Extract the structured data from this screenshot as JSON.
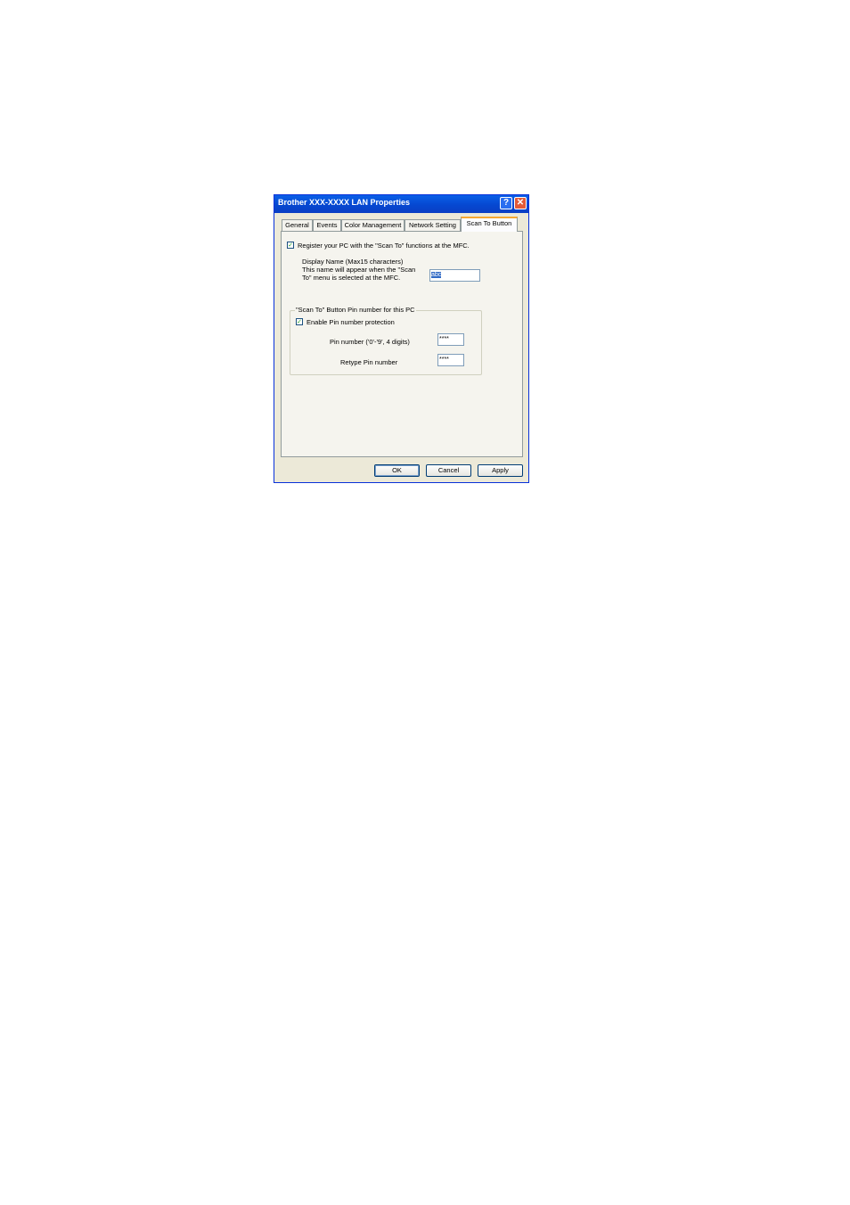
{
  "window": {
    "title": "Brother XXX-XXXX LAN Properties",
    "help_glyph": "?",
    "close_glyph": "✕"
  },
  "tabs": [
    {
      "label": "General"
    },
    {
      "label": "Events"
    },
    {
      "label": "Color Management"
    },
    {
      "label": "Network Setting"
    },
    {
      "label": "Scan To Button",
      "active": true
    }
  ],
  "register": {
    "checked": true,
    "check_glyph": "✓",
    "label": "Register your PC with the \"Scan To\" functions at the MFC."
  },
  "display_name": {
    "line1": "Display Name (Max15 characters)",
    "line2": "This name will appear when the \"Scan",
    "line3": "To\" menu is selected at the MFC.",
    "value": "abc"
  },
  "pin_group": {
    "title": "\"Scan To\" Button Pin number for this PC",
    "enable_label": "Enable Pin number protection",
    "enable_checked": true,
    "pin_label": "Pin number ('0'-'9', 4 digits)",
    "pin_value": "****",
    "retype_label": "Retype Pin number",
    "retype_value": "****"
  },
  "buttons": {
    "ok": "OK",
    "cancel": "Cancel",
    "apply": "Apply"
  },
  "colors": {
    "titlebar": "#0648d1",
    "dialog_bg": "#ece9d8",
    "tab_highlight": "#f7a832",
    "selection": "#316ac5"
  }
}
